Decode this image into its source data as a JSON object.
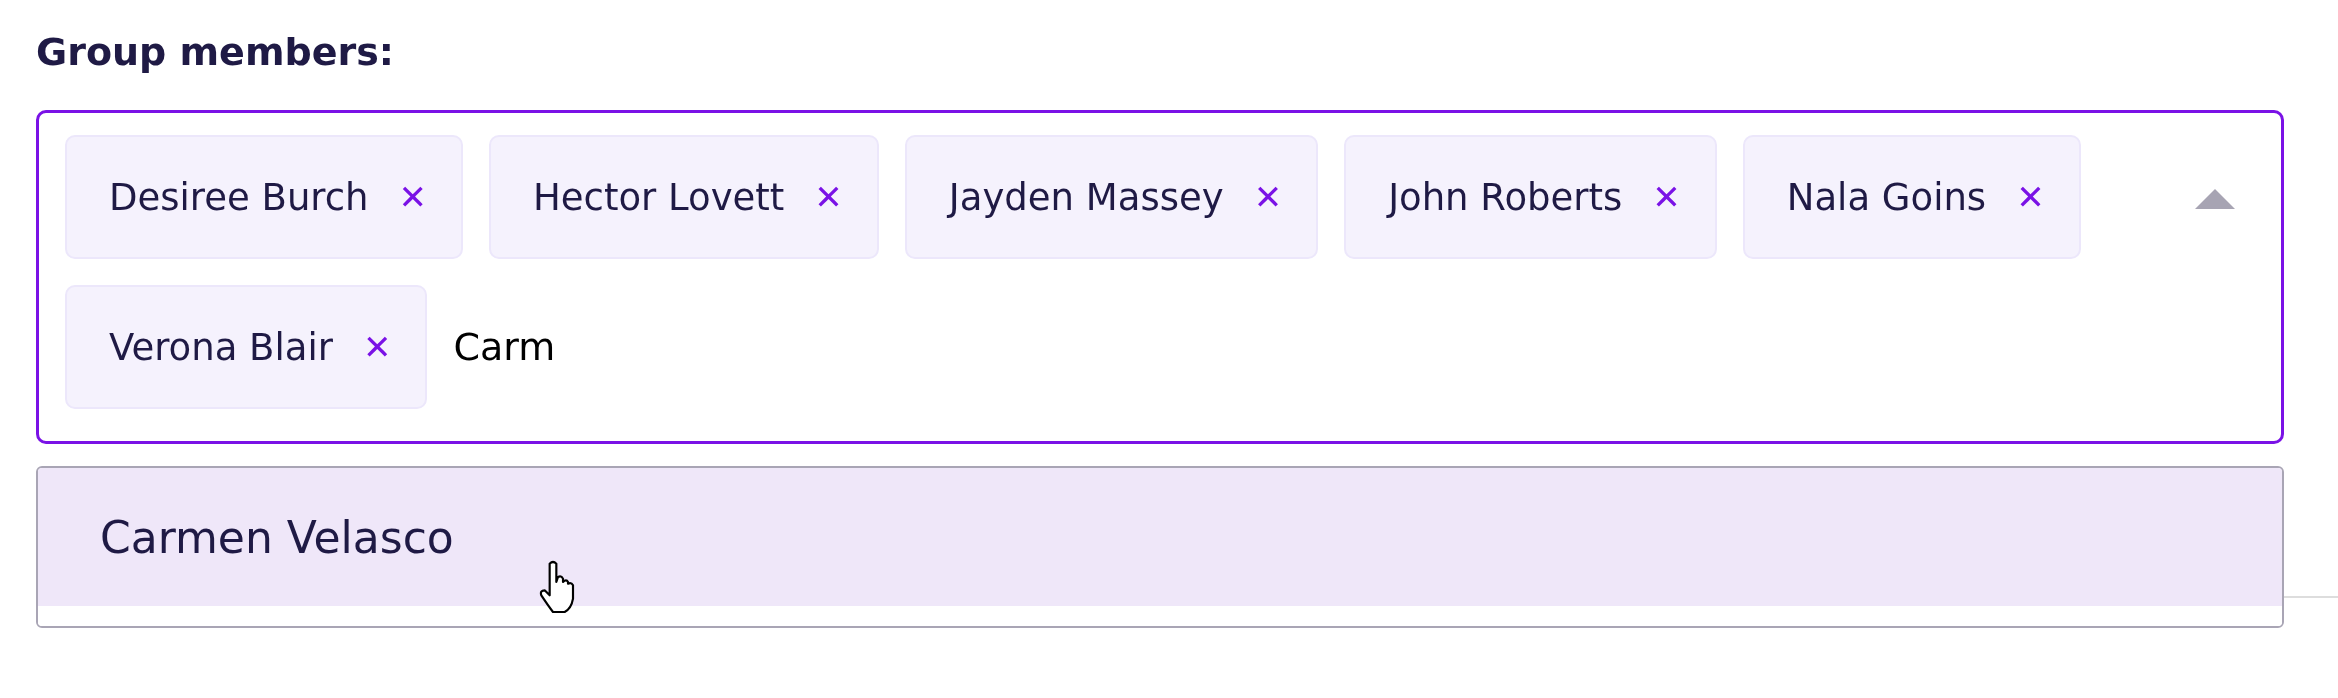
{
  "label": "Group members:",
  "chips": [
    {
      "name": "Desiree Burch",
      "remove": "✕"
    },
    {
      "name": "Hector Lovett",
      "remove": "✕"
    },
    {
      "name": "Jayden Massey",
      "remove": "✕"
    },
    {
      "name": "John Roberts",
      "remove": "✕"
    },
    {
      "name": "Nala Goins",
      "remove": "✕"
    },
    {
      "name": "Verona Blair",
      "remove": "✕"
    }
  ],
  "search": {
    "value": "Carm"
  },
  "expanded": true,
  "options": [
    {
      "label": "Carmen Velasco",
      "selected": true
    }
  ]
}
